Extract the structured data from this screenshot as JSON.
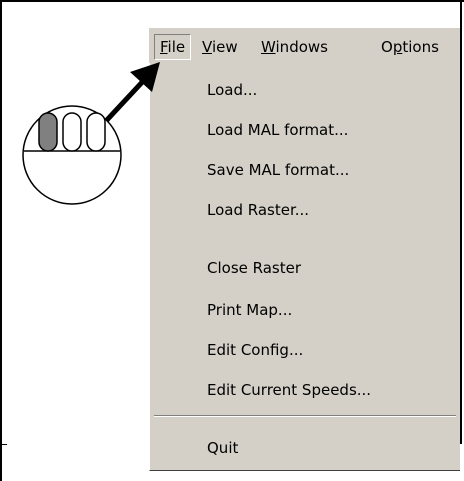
{
  "menubar": {
    "items": [
      {
        "label": "File",
        "mnemonic": "F"
      },
      {
        "label": "View",
        "mnemonic": "V"
      },
      {
        "label": "Windows",
        "mnemonic": "W"
      },
      {
        "label": "Options",
        "mnemonic": "p"
      }
    ]
  },
  "file_menu": {
    "items": [
      "Load...",
      "Load MAL format...",
      "Save MAL format...",
      "Load Raster...",
      "Close Raster",
      "Print Map...",
      "Edit Config...",
      "Edit Current Speeds...",
      "Quit"
    ]
  },
  "illustration": {
    "arrow": "pointer-arrow-icon",
    "mouse": "mouse-left-button-icon",
    "pressed_button_color": "#808080"
  },
  "colors": {
    "menu_background": "#d4d0c8",
    "text": "#000000"
  }
}
